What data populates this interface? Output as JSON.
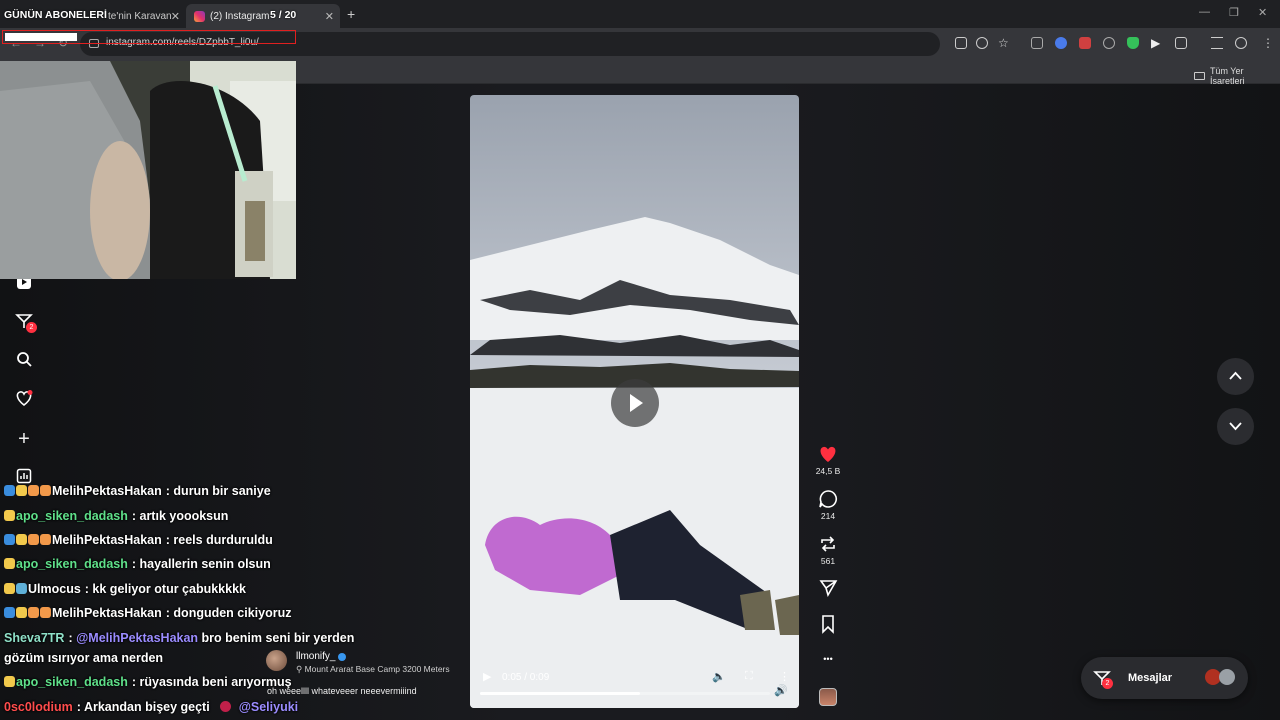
{
  "stream_overlay": {
    "title": "GÜNÜN ABONELERİ",
    "counter": "5 / 20"
  },
  "browser": {
    "tabs": [
      {
        "title": "te'nin Karavan",
        "active": false
      },
      {
        "title": "(2) Instagram",
        "active": true
      }
    ],
    "new_tab": "+",
    "url": "instagram.com/reels/DZpbbT_li0u/",
    "bookmarks_folder": "Tüm Yer İşaretleri"
  },
  "sidebar": {
    "notifications_badge": "2"
  },
  "reel": {
    "time": "0:05 / 0:09",
    "progress": 0.55,
    "author": "llmonify_",
    "location": "Mount Ararat Base Camp 3200 Meters",
    "caption": "oh weeellll whateveeer neeevermiiind"
  },
  "actions": {
    "likes": "24,5 B",
    "comments": "214",
    "reposts": "561",
    "more": "•••"
  },
  "messages": {
    "label": "Mesajlar",
    "badge": "2"
  },
  "chat": [
    {
      "user": "MelihPektasHakan",
      "color": "#ffffff",
      "icons": [
        "#3a8dde",
        "#f2c94c",
        "#f2994a",
        "#f2994a"
      ],
      "text": ": durun bir saniye"
    },
    {
      "user": "apo_siken_dadash",
      "color": "#5fe08a",
      "icons": [
        "#f2c94c"
      ],
      "text": ": artık yoooksun"
    },
    {
      "user": "MelihPektasHakan",
      "color": "#ffffff",
      "icons": [
        "#3a8dde",
        "#f2c94c",
        "#f2994a",
        "#f2994a"
      ],
      "text": ": reels durduruldu"
    },
    {
      "user": "apo_siken_dadash",
      "color": "#5fe08a",
      "icons": [
        "#f2c94c"
      ],
      "text": ": hayallerin senin olsun"
    },
    {
      "user": "Ulmocus",
      "color": "#ffffff",
      "icons": [
        "#f2c94c",
        "#5fb0d8"
      ],
      "text": ": kk geliyor otur çabukkkkk"
    },
    {
      "user": "MelihPektasHakan",
      "color": "#ffffff",
      "icons": [
        "#3a8dde",
        "#f2c94c",
        "#f2994a",
        "#f2994a"
      ],
      "text": ": donguden cikiyoruz"
    },
    {
      "user": "Sheva7TR",
      "color": "#8fe0c8",
      "icons": [],
      "text": ":",
      "mention": "@MelihPektasHakan",
      "after": " bro benim seni bir yerden"
    },
    {
      "user": "",
      "color": "#ffffff",
      "icons": [],
      "text": "gözüm ısırıyor ama nerden"
    },
    {
      "user": "apo_siken_dadash",
      "color": "#5fe08a",
      "icons": [
        "#f2c94c"
      ],
      "text": ": rüyasında beni arıyormuş"
    },
    {
      "user": "0sc0lodium",
      "color": "#ff4d4d",
      "icons": [],
      "text": ": Arkandan bişey geçti",
      "mention": "@Seliyuki",
      "mention_prefix": true
    }
  ]
}
